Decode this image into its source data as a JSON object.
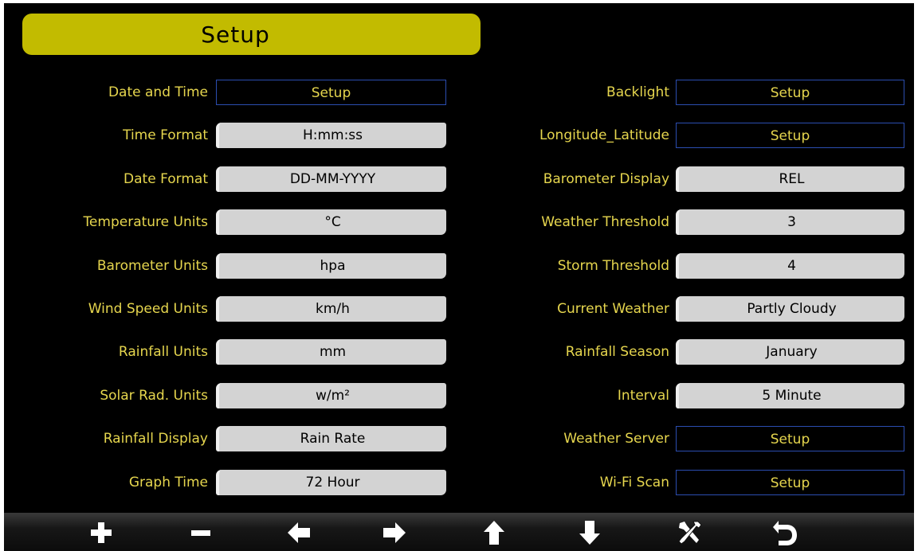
{
  "header": {
    "title": "Setup"
  },
  "left_rows": [
    {
      "label": "Date and Time",
      "value": "Setup",
      "kind": "setup"
    },
    {
      "label": "Time Format",
      "value": "H:mm:ss",
      "kind": "value"
    },
    {
      "label": "Date Format",
      "value": "DD-MM-YYYY",
      "kind": "value"
    },
    {
      "label": "Temperature Units",
      "value": "°C",
      "kind": "value"
    },
    {
      "label": "Barometer Units",
      "value": "hpa",
      "kind": "value"
    },
    {
      "label": "Wind Speed Units",
      "value": "km/h",
      "kind": "value"
    },
    {
      "label": "Rainfall Units",
      "value": "mm",
      "kind": "value"
    },
    {
      "label": "Solar Rad. Units",
      "value": "w/m²",
      "kind": "value"
    },
    {
      "label": "Rainfall Display",
      "value": "Rain Rate",
      "kind": "value"
    },
    {
      "label": "Graph  Time",
      "value": "72 Hour",
      "kind": "value"
    }
  ],
  "right_rows": [
    {
      "label": "Backlight",
      "value": "Setup",
      "kind": "setup"
    },
    {
      "label": "Longitude_Latitude",
      "value": "Setup",
      "kind": "setup"
    },
    {
      "label": "Barometer Display",
      "value": "REL",
      "kind": "value"
    },
    {
      "label": "Weather Threshold",
      "value": "3",
      "kind": "value"
    },
    {
      "label": "Storm Threshold",
      "value": "4",
      "kind": "value"
    },
    {
      "label": "Current Weather",
      "value": "Partly Cloudy",
      "kind": "value"
    },
    {
      "label": "Rainfall Season",
      "value": "January",
      "kind": "value"
    },
    {
      "label": "Interval",
      "value": "5 Minute",
      "kind": "value"
    },
    {
      "label": "Weather Server",
      "value": "Setup",
      "kind": "setup"
    },
    {
      "label": "Wi-Fi Scan",
      "value": "Setup",
      "kind": "setup"
    }
  ],
  "toolbar": {
    "buttons": [
      {
        "name": "plus-button",
        "icon": "plus-icon"
      },
      {
        "name": "minus-button",
        "icon": "minus-icon"
      },
      {
        "name": "left-button",
        "icon": "arrow-left-icon"
      },
      {
        "name": "right-button",
        "icon": "arrow-right-icon"
      },
      {
        "name": "up-button",
        "icon": "arrow-up-icon"
      },
      {
        "name": "down-button",
        "icon": "arrow-down-icon"
      },
      {
        "name": "tools-button",
        "icon": "tools-icon"
      },
      {
        "name": "back-button",
        "icon": "return-icon"
      }
    ]
  },
  "colors": {
    "background": "#000000",
    "title_bar": "#c2bb00",
    "label": "#e6d64e",
    "value_box": "#d3d3d3",
    "setup_border": "#2b4db0",
    "toolbar_icon": "#ffffff"
  }
}
